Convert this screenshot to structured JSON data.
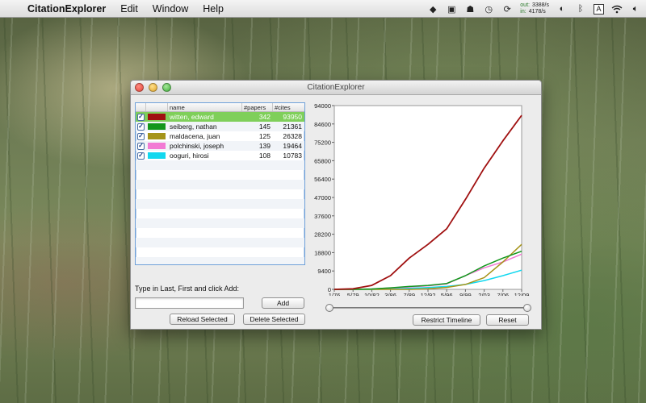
{
  "menubar": {
    "app_name": "CitationExplorer",
    "items": [
      "Edit",
      "Window",
      "Help"
    ],
    "net_out_label": "out:",
    "net_out_value": "3388/s",
    "net_in_label": "in:",
    "net_in_value": "4178/s",
    "input_menu": "A"
  },
  "window": {
    "title": "CitationExplorer"
  },
  "table": {
    "headers": [
      "",
      "",
      "name",
      "#papers",
      "#cites"
    ],
    "rows": [
      {
        "checked": true,
        "color": "#a01010",
        "name": "witten, edward",
        "papers": "342",
        "cites": "93950",
        "selected": true
      },
      {
        "checked": true,
        "color": "#12961c",
        "name": "seiberg, nathan",
        "papers": "145",
        "cites": "21361",
        "selected": false
      },
      {
        "checked": true,
        "color": "#a59419",
        "name": "maldacena, juan",
        "papers": "125",
        "cites": "26328",
        "selected": false
      },
      {
        "checked": true,
        "color": "#f27ad4",
        "name": "polchinski, joseph",
        "papers": "139",
        "cites": "19464",
        "selected": false
      },
      {
        "checked": true,
        "color": "#12d8ef",
        "name": "ooguri, hirosi",
        "papers": "108",
        "cites": "10783",
        "selected": false
      }
    ]
  },
  "controls": {
    "add_prompt": "Type in Last, First and click Add:",
    "add_input_value": "",
    "add_button": "Add",
    "reload_button": "Reload Selected",
    "delete_button": "Delete Selected",
    "restrict_button": "Restrict Timeline",
    "reset_button": "Reset"
  },
  "chart_data": {
    "type": "line",
    "title": "",
    "xlabel": "",
    "ylabel": "",
    "x": [
      "1/76",
      "5/79",
      "10/82",
      "3/86",
      "7/89",
      "12/92",
      "5/96",
      "9/99",
      "2/03",
      "7/06",
      "12/09"
    ],
    "y_ticks": [
      "0",
      "9400",
      "18800",
      "28200",
      "37600",
      "47000",
      "56400",
      "65800",
      "75200",
      "84600",
      "94000"
    ],
    "ylim": [
      0,
      94000
    ],
    "grid": false,
    "series": [
      {
        "color": "#a01010",
        "values": [
          0,
          300,
          2000,
          7000,
          16000,
          23000,
          31000,
          46000,
          62000,
          76000,
          89000
        ]
      },
      {
        "color": "#12961c",
        "values": [
          0,
          0,
          200,
          800,
          1500,
          2000,
          3000,
          7000,
          12000,
          16000,
          19500
        ]
      },
      {
        "color": "#a59419",
        "values": [
          0,
          0,
          0,
          0,
          0,
          300,
          1000,
          2500,
          6000,
          14000,
          23000
        ]
      },
      {
        "color": "#f27ad4",
        "values": [
          0,
          0,
          200,
          700,
          1200,
          1800,
          2800,
          7000,
          11000,
          14000,
          18000
        ]
      },
      {
        "color": "#12d8ef",
        "values": [
          0,
          0,
          0,
          200,
          500,
          900,
          1500,
          2500,
          4500,
          7000,
          9800
        ]
      }
    ]
  }
}
